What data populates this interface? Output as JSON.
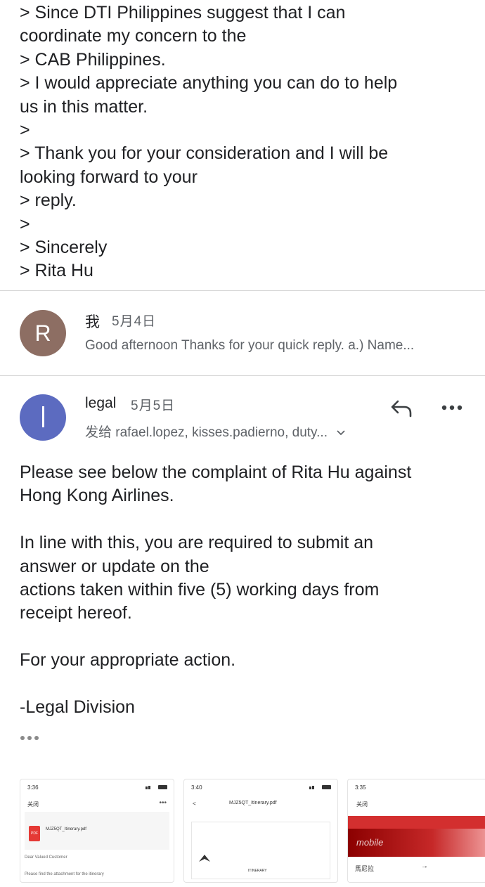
{
  "quoted_lines": [
    "> Since DTI Philippines suggest that I can",
    "coordinate my concern to the",
    "> CAB Philippines.",
    "> I would appreciate anything you can do to help",
    "us in this matter.",
    ">",
    "> Thank you for your consideration and I will be",
    "looking forward to your",
    "> reply.",
    ">",
    "> Sincerely",
    "> Rita Hu"
  ],
  "message1": {
    "avatar_letter": "R",
    "avatar_color": "#8d6e63",
    "sender": "我",
    "date": "5月4日",
    "snippet": "Good afternoon Thanks for your quick reply. a.) Name..."
  },
  "message2": {
    "avatar_letter": "l",
    "avatar_color": "#5c6bc0",
    "sender": "legal",
    "date": "5月5日",
    "to_line": "发给 rafael.lopez, kisses.padierno, duty...",
    "reply_icon": "reply-icon",
    "more_icon": "more-horizontal-icon",
    "expand_icon": "chevron-down-icon",
    "body": [
      [
        "Please see below the complaint of Rita Hu against",
        "Hong Kong Airlines."
      ],
      [
        "In line with this, you are required to submit an",
        "answer or update on the",
        "actions taken within five (5) working days from",
        "receipt hereof."
      ],
      [
        "For your appropriate action."
      ],
      [
        "-Legal Division"
      ]
    ],
    "trimmed_content_icon": "ellipsis-icon"
  },
  "attachments": [
    {
      "time": "3:36",
      "header": "关闭",
      "file_name": "MJZ5QT_Itinerary.pdf",
      "file_badge": "PDF",
      "line1": "Dear Valued Customer",
      "line2": "Please find the attachment for the itinerary"
    },
    {
      "time": "3:40",
      "header": "MJZ5QT_Itinerary.pdf",
      "footer": "ITINERARY"
    },
    {
      "time": "3:35",
      "header": "关闭",
      "line1": "馬尼拉",
      "watermark": "mobile"
    }
  ]
}
